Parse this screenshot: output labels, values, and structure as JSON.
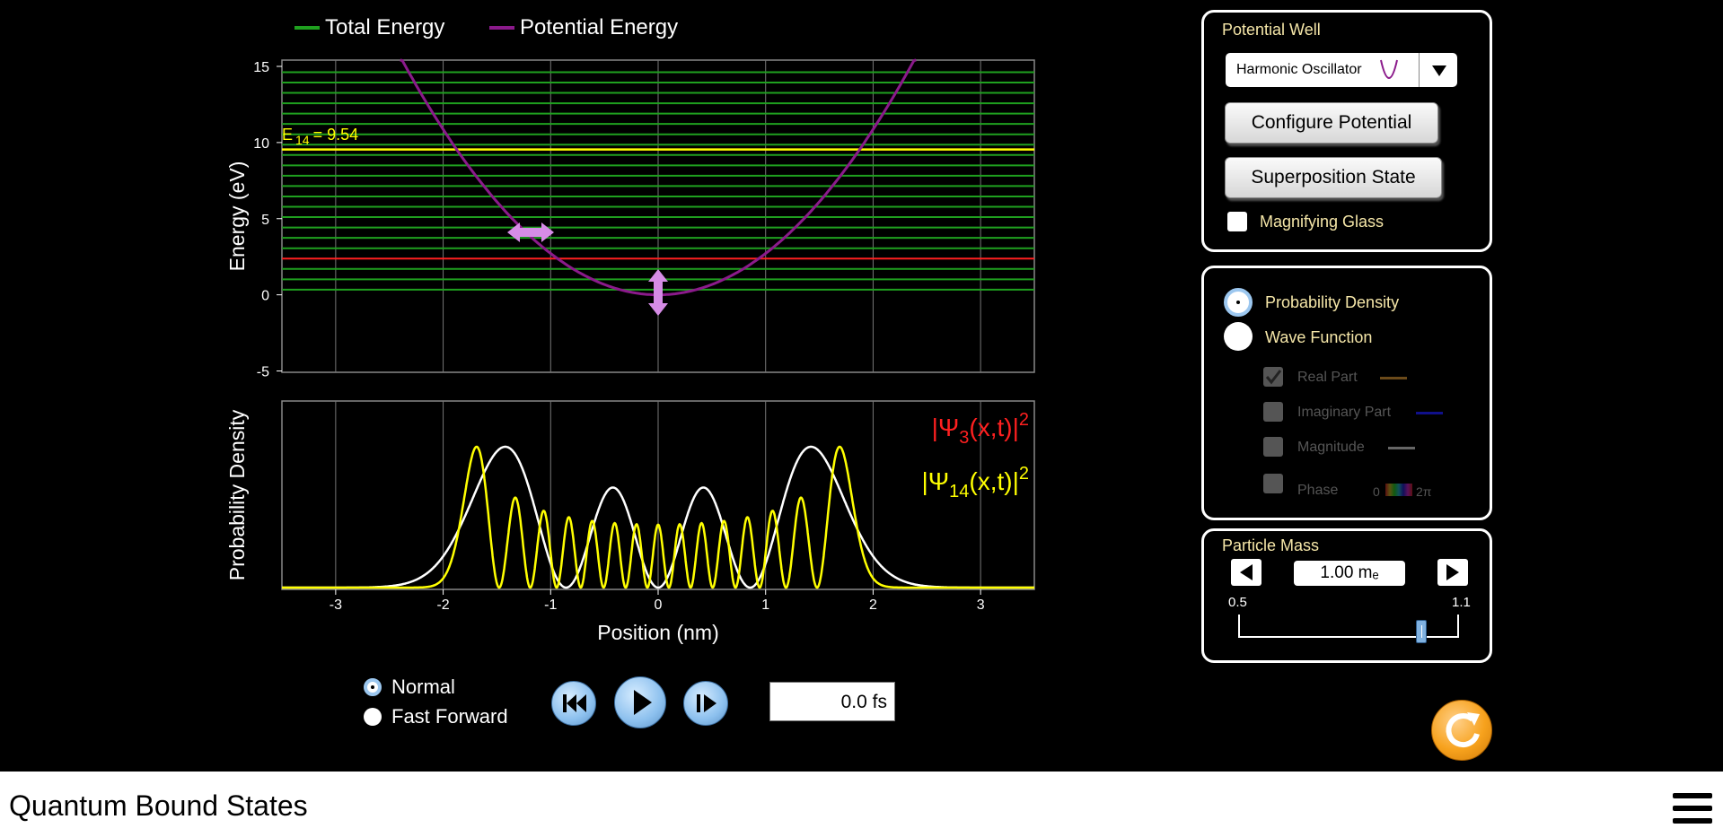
{
  "app": {
    "title": "Quantum Bound States"
  },
  "legend": {
    "total": "Total Energy",
    "potential": "Potential Energy",
    "total_color": "#1fa01f",
    "potential_color": "#8b1a8b"
  },
  "energy_plot": {
    "ylabel": "Energy (eV)",
    "yticks": [
      "15",
      "10",
      "5",
      "0",
      "-5"
    ],
    "selected_label_prefix": "E",
    "selected_label_sub": "14",
    "selected_label_value": "= 9.54"
  },
  "density_plot": {
    "ylabel": "Probability Density",
    "xlabel": "Position (nm)",
    "xticks": [
      "-3",
      "-2",
      "-1",
      "0",
      "1",
      "2",
      "3"
    ],
    "psi3_pre": "|Ψ",
    "psi3_sub": "3",
    "psi3_post": "(x,t)|",
    "psi3_sup": "2",
    "psi14_pre": "|Ψ",
    "psi14_sub": "14",
    "psi14_post": "(x,t)|",
    "psi14_sup": "2"
  },
  "chart_data": {
    "type": "line",
    "energy": {
      "ylim": [
        -5,
        15
      ],
      "xlim": [
        -3.5,
        3.5
      ],
      "potential": "0.5*k*x^2 (harmonic oscillator)",
      "levels_ev": [
        0.34,
        1.02,
        1.7,
        2.38,
        3.06,
        3.74,
        4.42,
        5.1,
        5.78,
        6.46,
        7.14,
        7.82,
        8.5,
        9.18,
        9.86,
        10.54,
        11.22,
        11.9,
        12.58,
        13.26,
        13.94,
        14.62
      ],
      "selected_state_index": 14,
      "selected_energy_ev": 9.54,
      "highlight_red_ev": 2.38
    },
    "density": {
      "series": [
        {
          "name": "|Ψ3(x,t)|²",
          "color": "#ffffff",
          "n": 3
        },
        {
          "name": "|Ψ14(x,t)|²",
          "color": "#ffff00",
          "n": 14
        }
      ]
    }
  },
  "controls": {
    "speed_normal": "Normal",
    "speed_ff": "Fast Forward",
    "time_value": "0.0 fs"
  },
  "potential_panel": {
    "title": "Potential Well",
    "combo_label": "Harmonic Oscillator",
    "configure": "Configure Potential",
    "superposition": "Superposition State",
    "magnifier": "Magnifying Glass"
  },
  "view_panel": {
    "prob_density": "Probability Density",
    "wave_function": "Wave Function",
    "real_part": "Real Part",
    "imag_part": "Imaginary Part",
    "magnitude": "Magnitude",
    "phase": "Phase",
    "phase_min": "0",
    "phase_max": "2π"
  },
  "mass_panel": {
    "title": "Particle Mass",
    "value": "1.00 mₑ",
    "min": "0.5",
    "max": "1.1",
    "level": 0.83
  }
}
